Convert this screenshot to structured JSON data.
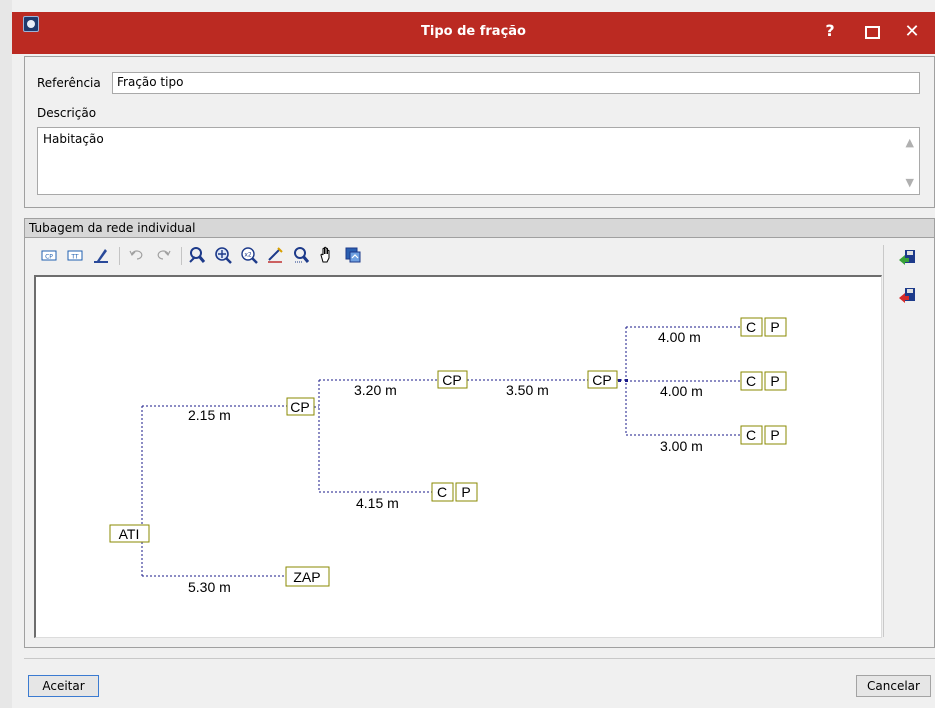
{
  "window": {
    "title": "Tipo de fração",
    "help_label": "?",
    "close_label": "✕"
  },
  "form": {
    "reference_label": "Referência",
    "reference_value": "Fração tipo",
    "description_label": "Descrição",
    "description_value": "Habitação"
  },
  "network": {
    "section_title": "Tubagem da rede individual",
    "toolbar": [
      "cp-icon",
      "tt-icon",
      "edit-pen-icon",
      "undo-icon",
      "redo-icon",
      "zoom-window-icon",
      "zoom-all-icon",
      "zoom-x2-icon",
      "measure-icon",
      "zoom-out-icon",
      "pan-hand-icon",
      "copy-image-icon"
    ],
    "side_icons": [
      "import-green-icon",
      "export-red-icon"
    ],
    "nodes": {
      "ati": "ATI",
      "cp1": "CP",
      "cp2": "CP",
      "cp3": "CP",
      "zap": "ZAP",
      "c": "C",
      "p": "P"
    },
    "lengths": {
      "ati_cp1": "2.15 m",
      "ati_zap": "5.30 m",
      "cp1_cp2": "3.20 m",
      "cp1_cp_low": "4.15 m",
      "cp2_cp3": "3.50 m",
      "cp3_top": "4.00 m",
      "cp3_mid": "4.00 m",
      "cp3_bot": "3.00 m"
    },
    "colors": {
      "pipe": "#1a1a8a",
      "node_border": "#8a8a00"
    }
  },
  "footer": {
    "accept_label": "Aceitar",
    "cancel_label": "Cancelar"
  }
}
